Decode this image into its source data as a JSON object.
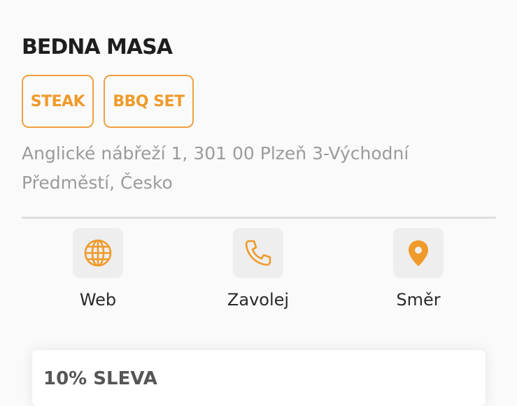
{
  "place": {
    "name": "BEDNA MASA",
    "tags": [
      "STEAK",
      "BBQ SET"
    ],
    "address": "Anglické nábřeží 1, 301 00 Plzeň 3-Východní Předměstí, Česko"
  },
  "actions": {
    "web": {
      "label": "Web",
      "icon": "globe-icon"
    },
    "call": {
      "label": "Zavolej",
      "icon": "phone-icon"
    },
    "directions": {
      "label": "Směr",
      "icon": "map-pin-icon"
    }
  },
  "offer": {
    "title": "10% SLEVA"
  },
  "colors": {
    "accent": "#ef9a2a",
    "background": "#fafafa",
    "muted_text": "#9b9b9b",
    "icon_box": "#eeeeee"
  }
}
